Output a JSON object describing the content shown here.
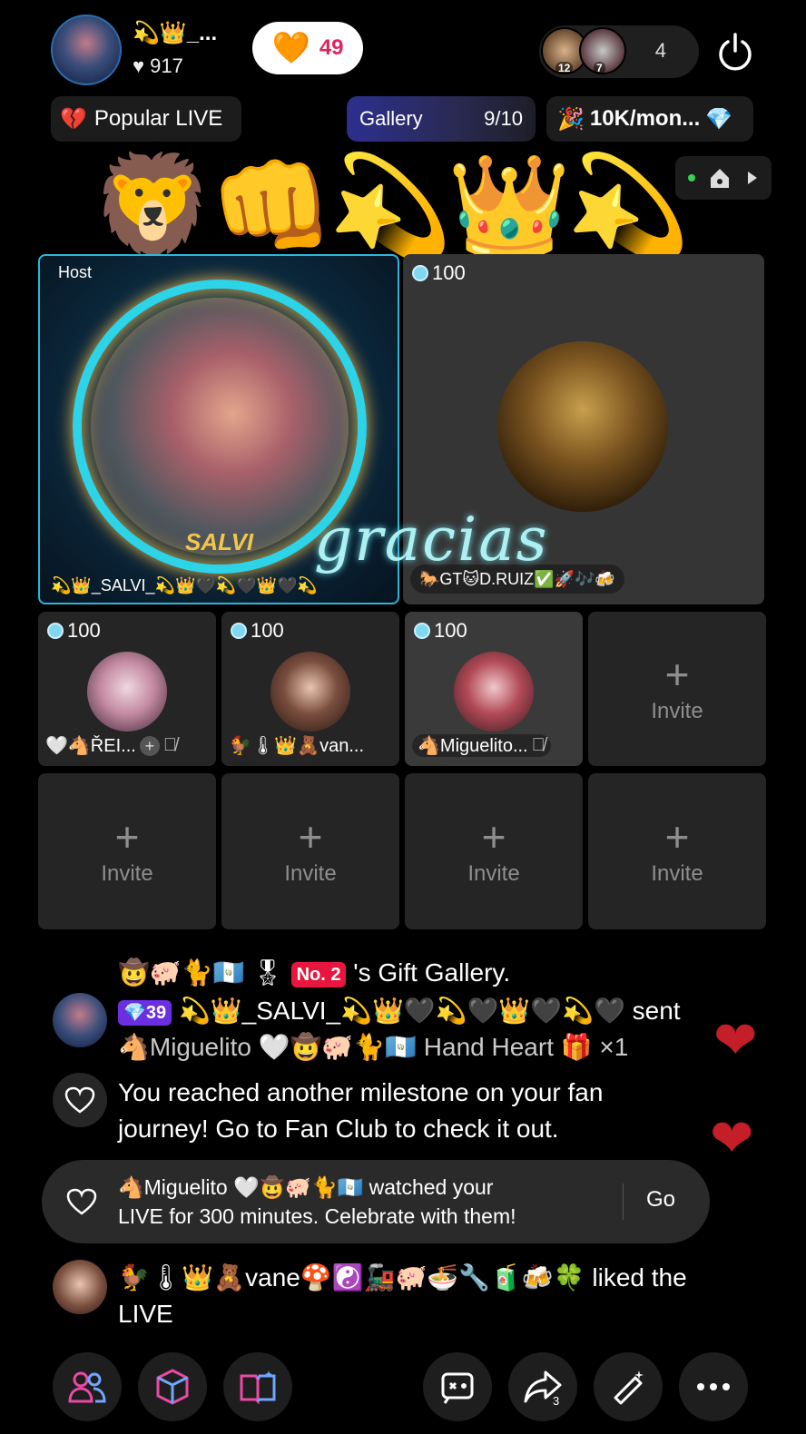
{
  "header": {
    "host_name": "💫👑_...",
    "likes": "♥ 917",
    "fan_heart": "🧡",
    "fan_count": "49",
    "viewer_ranks": [
      "12",
      "7"
    ],
    "viewer_count": "4"
  },
  "pills": {
    "popular_icon": "💔",
    "popular_label": "Popular LIVE",
    "gallery_label": "Gallery",
    "gallery_progress": "9/10",
    "month_icon": "🎉",
    "month_label": "10K/mon...",
    "month_gem": "💎"
  },
  "emoji_row": "🦁👊💫👑💫",
  "overlay_text": "gracias",
  "seats": {
    "host": {
      "tag": "Host",
      "frame_label": "SALVI",
      "name": "💫👑_SALVI_💫👑🖤💫🖤👑🖤💫"
    },
    "guest_main": {
      "badge": "100",
      "name": "🐎GT🐱D.RUIZ✅🚀🎶🍻"
    },
    "small": [
      {
        "badge": "100",
        "name": "🤍🐴ŘEI...",
        "add": "+",
        "mute": "🎙̸"
      },
      {
        "badge": "100",
        "name": "🐓🌡👑🧸van..."
      },
      {
        "badge": "100",
        "name": "🐴Miguelito...",
        "mute": "🎙̸"
      }
    ],
    "invite_plus": "+",
    "invite_label": "Invite"
  },
  "chat": {
    "gallery_line": {
      "prefix": "🤠🐖🐈🇬🇹",
      "badge_icon": "🎖",
      "badge": "No. 2",
      "suffix": "'s Gift Gallery."
    },
    "gift_line": {
      "level": "💎39",
      "line1": "💫👑_SALVI_💫👑🖤💫🖤👑🖤💫🖤 sent",
      "line2": "🐴Miguelito 🤍🤠🐖🐈🇬🇹 Hand Heart 🎁 ×1"
    },
    "milestone": {
      "line1": "You reached another milestone on your fan",
      "line2": "journey! Go to Fan Club to check it out."
    },
    "fan_card": {
      "line1": "🐴Miguelito 🤍🤠🐖🐈🇬🇹 watched your",
      "line2": "LIVE for 300 minutes. Celebrate with them!",
      "action": "Go"
    },
    "liked": {
      "line1": "🐓🌡👑🧸vane🍄☯️🚂🐖🍜🔧🧃🍻🍀 liked the",
      "line2": "LIVE"
    },
    "floating_heart": "❤"
  },
  "bottom_bar": {
    "share_count": "3"
  },
  "colors": {
    "accent_blue": "#2bb6d8",
    "heart_red": "#c41e28",
    "gallery_purple": "#2c2f8f"
  }
}
